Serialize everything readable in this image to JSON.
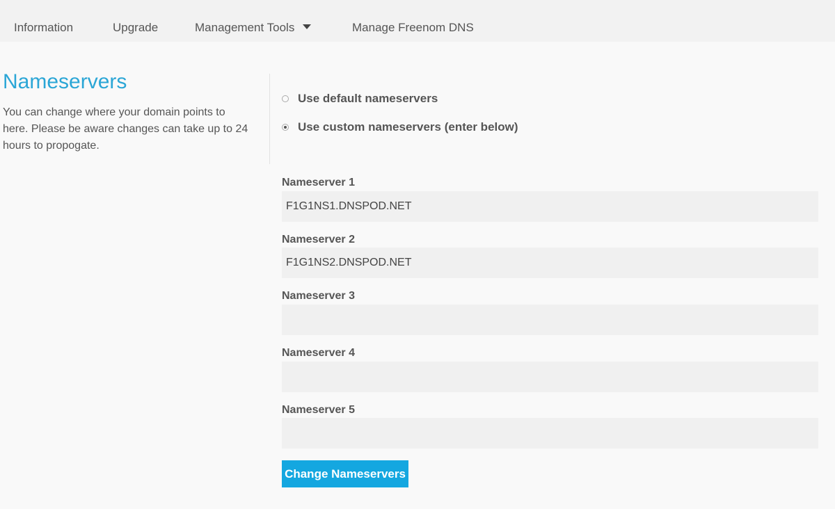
{
  "nav": {
    "items": [
      {
        "label": "Information"
      },
      {
        "label": "Upgrade"
      },
      {
        "label": "Management Tools",
        "has_dropdown": true
      },
      {
        "label": "Manage Freenom DNS"
      }
    ]
  },
  "section": {
    "title": "Nameservers",
    "description": "You can change where your domain points to here. Please be aware changes can take up to 24 hours to propogate."
  },
  "options": {
    "default_label": "Use default nameservers",
    "custom_label": "Use custom nameservers (enter below)",
    "selected": "custom"
  },
  "nameservers": [
    {
      "label": "Nameserver 1",
      "value": "F1G1NS1.DNSPOD.NET"
    },
    {
      "label": "Nameserver 2",
      "value": "F1G1NS2.DNSPOD.NET"
    },
    {
      "label": "Nameserver 3",
      "value": ""
    },
    {
      "label": "Nameserver 4",
      "value": ""
    },
    {
      "label": "Nameserver 5",
      "value": ""
    }
  ],
  "submit_label": "Change Nameservers",
  "colors": {
    "accent": "#2ba6d6",
    "button": "#14a7e0",
    "nav_bg": "#f2f2f2",
    "input_bg": "#f0f0f0"
  },
  "icons": {
    "dropdown": "caret-down-icon"
  }
}
